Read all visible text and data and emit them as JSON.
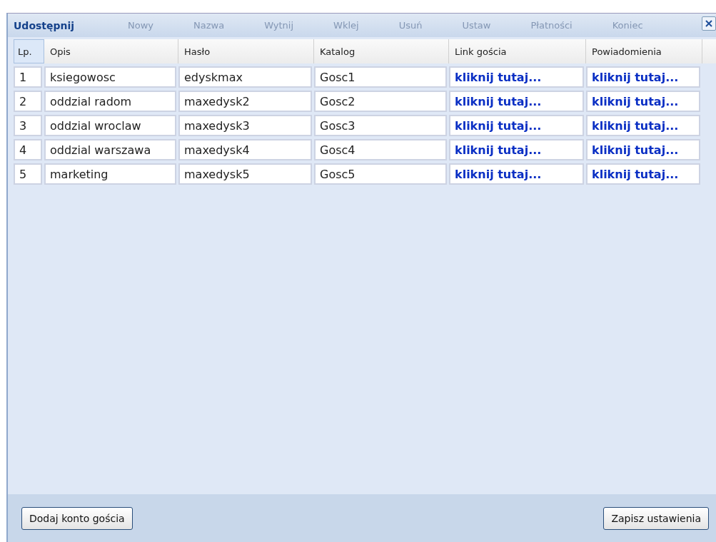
{
  "window": {
    "title": "Udostępnij"
  },
  "background_toolbar": [
    "Nowy",
    "Nazwa",
    "Wytnij",
    "Wklej",
    "Usuń",
    "Ustaw",
    "Płatności",
    "Koniec"
  ],
  "table": {
    "columns": [
      "Lp.",
      "Opis",
      "Hasło",
      "Katalog",
      "Link gościa",
      "Powiadomienia"
    ],
    "rows": [
      {
        "lp": "1",
        "opis": "ksiegowosc",
        "haslo": "edyskmax",
        "katalog": "Gosc1",
        "link": "kliknij tutaj...",
        "powiadomienia": "kliknij tutaj..."
      },
      {
        "lp": "2",
        "opis": "oddzial radom",
        "haslo": "maxedysk2",
        "katalog": "Gosc2",
        "link": "kliknij tutaj...",
        "powiadomienia": "kliknij tutaj..."
      },
      {
        "lp": "3",
        "opis": "oddzial wroclaw",
        "haslo": "maxedysk3",
        "katalog": "Gosc3",
        "link": "kliknij tutaj...",
        "powiadomienia": "kliknij tutaj..."
      },
      {
        "lp": "4",
        "opis": "oddzial warszawa",
        "haslo": "maxedysk4",
        "katalog": "Gosc4",
        "link": "kliknij tutaj...",
        "powiadomienia": "kliknij tutaj..."
      },
      {
        "lp": "5",
        "opis": "marketing",
        "haslo": "maxedysk5",
        "katalog": "Gosc5",
        "link": "kliknij tutaj...",
        "powiadomienia": "kliknij tutaj..."
      }
    ]
  },
  "buttons": [
    "Dodaj konto gościa",
    "Zapisz ustawienia"
  ]
}
